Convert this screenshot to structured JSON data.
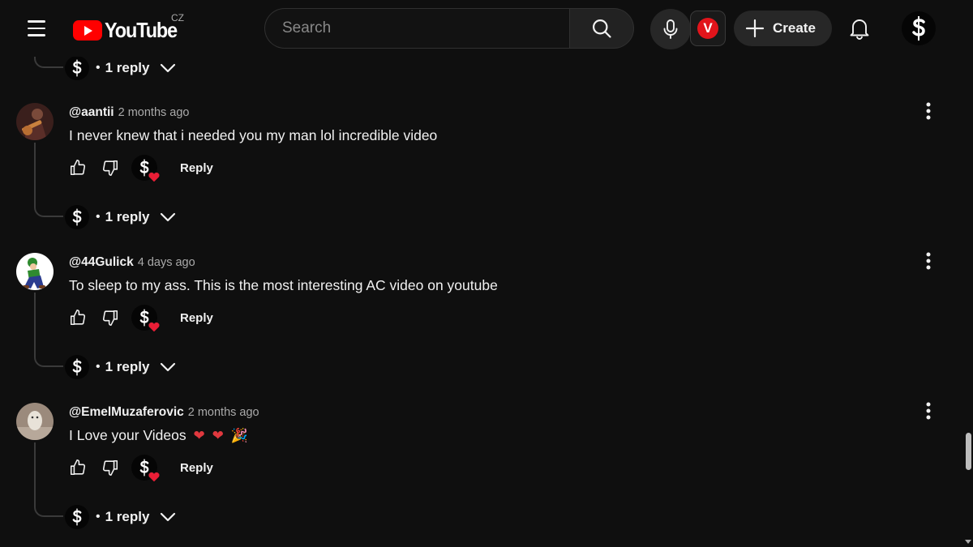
{
  "header": {
    "logo_text": "YouTube",
    "country_code": "CZ",
    "search_placeholder": "Search",
    "extension_letter": "V",
    "create_label": "Create"
  },
  "colors": {
    "background": "#0f0f0f",
    "brand_red": "#ff0000",
    "heart": "#e91e36",
    "muted_text": "#aaaaaa"
  },
  "top_reply": {
    "dot": "•",
    "reply_count": "1 reply"
  },
  "comments": [
    {
      "author": "@aantii",
      "time": "2 months ago",
      "text": "I never knew that i needed you my man lol incredible video",
      "emojis": [],
      "reply_label": "Reply",
      "dot": "•",
      "reply_count": "1 reply"
    },
    {
      "author": "@44Gulick",
      "time": "4 days ago",
      "text": "To sleep to my ass. This is the most interesting AC video on youtube",
      "emojis": [],
      "reply_label": "Reply",
      "dot": "•",
      "reply_count": "1 reply"
    },
    {
      "author": "@EmelMuzaferovic",
      "time": "2 months ago",
      "text": "I Love your Videos",
      "emojis": [
        "❤",
        "❤",
        "🎉"
      ],
      "reply_label": "Reply",
      "dot": "•",
      "reply_count": "1 reply"
    }
  ]
}
